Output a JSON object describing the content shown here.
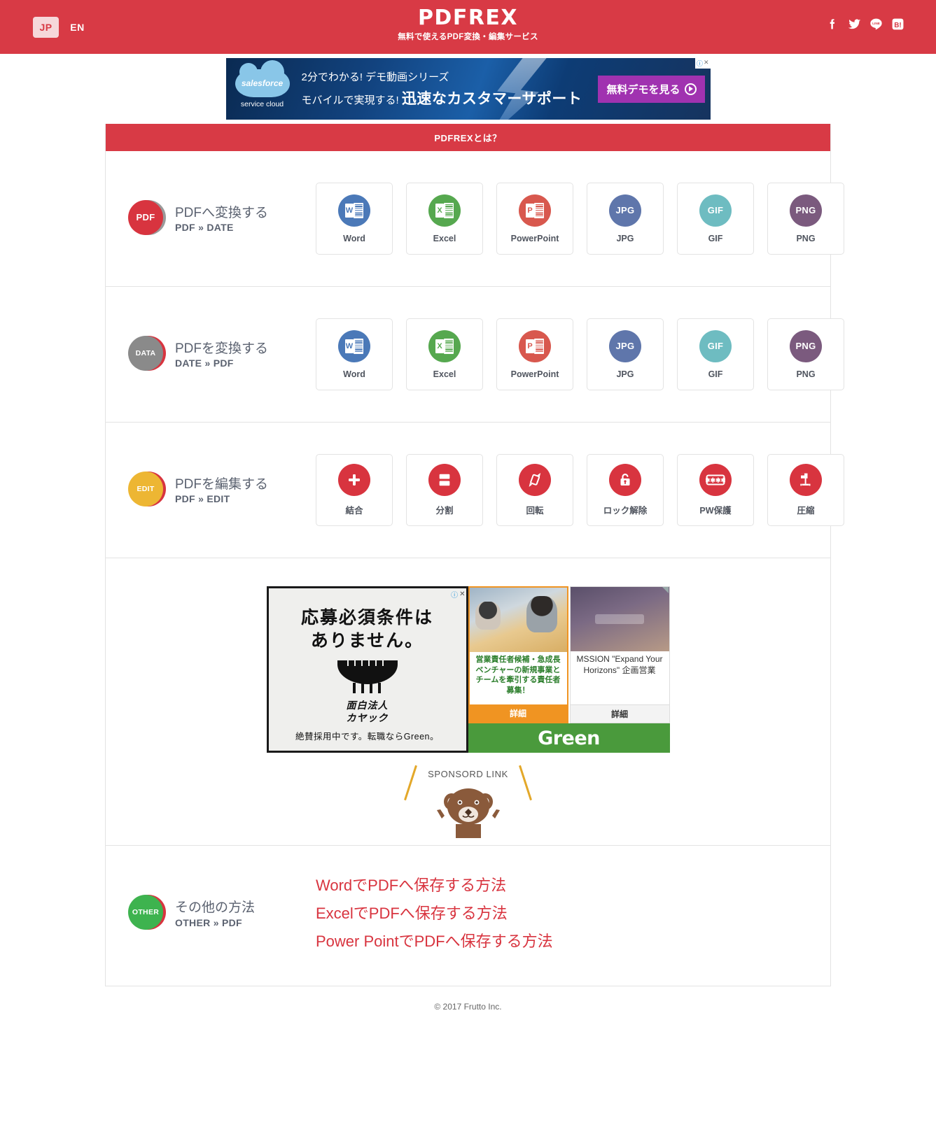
{
  "header": {
    "lang_jp": "JP",
    "lang_en": "EN",
    "logo": "PDFREX",
    "tagline": "無料で使えるPDF変換・編集サービス",
    "social": [
      "facebook-icon",
      "twitter-icon",
      "line-icon",
      "hatena-icon"
    ]
  },
  "top_ad": {
    "brand": "salesforce",
    "brand_sub": "service cloud",
    "line1": "2分でわかる! デモ動画シリーズ",
    "line2_prefix": "モバイルで実現する!",
    "line2_strong": "迅速なカスタマーサポート",
    "cta": "無料デモを見る",
    "badge_i": "ⓘ",
    "badge_x": "✕"
  },
  "main": {
    "section_title": "PDFREXとは？",
    "rows": [
      {
        "badge": "PDF",
        "badge_front_color": "#d8343f",
        "badge_back_color": "#9a9a9a",
        "title_jp": "PDFへ変換する",
        "title_en": "PDF » DATE",
        "tiles": [
          {
            "label": "Word",
            "icon": "word-icon",
            "color": "#4b79b8",
            "glyph": "W"
          },
          {
            "label": "Excel",
            "icon": "excel-icon",
            "color": "#56a košer"
          },
          {
            "label": "PowerPoint",
            "icon": "powerpoint-icon",
            "color": "#d8584e",
            "glyph": "P"
          },
          {
            "label": "JPG",
            "icon": "jpg-icon",
            "color": "#5f76ab",
            "text": "JPG"
          },
          {
            "label": "GIF",
            "icon": "gif-icon",
            "color": "#6ebcc1",
            "text": "GIF"
          },
          {
            "label": "PNG",
            "icon": "png-icon",
            "color": "#7b5a7e",
            "text": "PNG"
          }
        ]
      },
      {
        "badge": "DATA",
        "badge_front_color": "#8a8a8a",
        "badge_back_color": "#d8343f",
        "title_jp": "PDFを変換する",
        "title_en": "DATE » PDF",
        "tiles": [
          {
            "label": "Word",
            "icon": "word-icon",
            "color": "#4b79b8",
            "glyph": "W"
          },
          {
            "label": "Excel",
            "icon": "excel-icon",
            "color": "#56a84f",
            "glyph": "X"
          },
          {
            "label": "PowerPoint",
            "icon": "powerpoint-icon",
            "color": "#d8584e",
            "glyph": "P"
          },
          {
            "label": "JPG",
            "icon": "jpg-icon",
            "color": "#5f76ab",
            "text": "JPG"
          },
          {
            "label": "GIF",
            "icon": "gif-icon",
            "color": "#6ebcc1",
            "text": "GIF"
          },
          {
            "label": "PNG",
            "icon": "png-icon",
            "color": "#7b5a7e",
            "text": "PNG"
          }
        ]
      },
      {
        "badge": "EDIT",
        "badge_front_color": "#edb633",
        "badge_back_color": "#d8343f",
        "title_jp": "PDFを編集する",
        "title_en": "PDF » EDIT",
        "tiles": [
          {
            "label": "結合",
            "icon": "merge-plus-icon",
            "color": "#d8343f"
          },
          {
            "label": "分割",
            "icon": "split-icon",
            "color": "#d8343f"
          },
          {
            "label": "回転",
            "icon": "rotate-icon",
            "color": "#d8343f"
          },
          {
            "label": "ロック解除",
            "icon": "unlock-icon",
            "color": "#d8343f"
          },
          {
            "label": "PW保護",
            "icon": "password-icon",
            "color": "#d8343f"
          },
          {
            "label": "圧縮",
            "icon": "compress-icon",
            "color": "#d8343f"
          }
        ]
      }
    ]
  },
  "mid_ads": {
    "kayac": {
      "line1": "応募必須条件は",
      "line2": "ありません。",
      "brand_l1": "面白法人",
      "brand_l2": "カヤック",
      "footer": "絶賛採用中です。転職ならGreen。",
      "badge_i": "ⓘ",
      "badge_x": "✕"
    },
    "green": {
      "card1_title": "営業責任者候補・急成長ベンチャーの新規事業とチームを牽引する責任者募集！",
      "card1_cta": "詳細",
      "card2_title": "MSSION \"Expand Your Horizons\" 企画営業",
      "card2_cta": "詳細",
      "logo": "Green"
    },
    "sponsored_label": "SPONSORD LINK"
  },
  "other": {
    "badge": "OTHER",
    "badge_front_color": "#3eb34f",
    "badge_back_color": "#d8343f",
    "title_jp": "その他の方法",
    "title_en": "OTHER » PDF",
    "links": [
      "WordでPDFへ保存する方法",
      "ExcelでPDFへ保存する方法",
      "Power PointでPDFへ保存する方法"
    ]
  },
  "footer": {
    "copyright": "© 2017 Frutto Inc."
  }
}
